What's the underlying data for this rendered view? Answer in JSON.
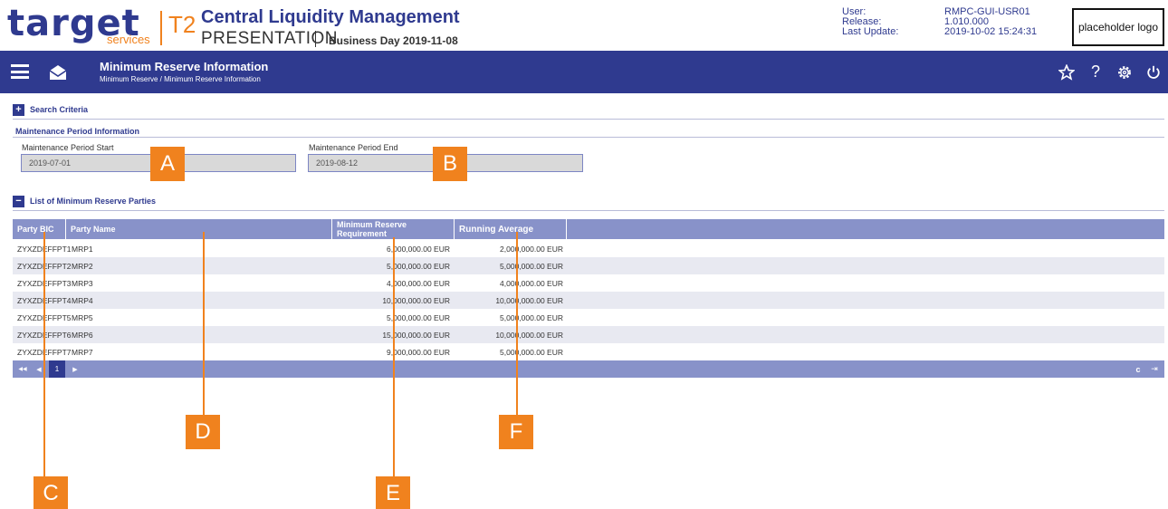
{
  "header": {
    "logo_target": "target",
    "logo_services": "services",
    "logo_t2": "T2",
    "app_title": "Central Liquidity Management",
    "environment": "PRESENTATION",
    "business_day": "Business Day 2019-11-08",
    "meta_labels": [
      "User:",
      "Release:",
      "Last Update:"
    ],
    "meta_values": [
      "RMPC-GUI-USR01",
      "1.010.000",
      "2019-10-02 15:24:31"
    ],
    "placeholder_logo": "placeholder logo"
  },
  "navbar": {
    "title": "Minimum Reserve Information",
    "breadcrumb": "Minimum Reserve  /  Minimum Reserve Information",
    "icons": [
      "menu-icon",
      "envelope-icon",
      "star-icon",
      "help-icon",
      "settings-icon",
      "power-icon"
    ],
    "help_glyph": "?"
  },
  "search_criteria": {
    "toggle": "+",
    "title": "Search Criteria"
  },
  "maintenance": {
    "title": "Maintenance Period Information",
    "start_label": "Maintenance Period Start",
    "start_value": "2019-07-01",
    "end_label": "Maintenance Period End",
    "end_value": "2019-08-12"
  },
  "list_section": {
    "toggle": "−",
    "title": "List of Minimum Reserve Parties"
  },
  "table": {
    "columns": [
      "Party BIC",
      "Party Name",
      "Minimum Reserve Requirement",
      "Running Average"
    ],
    "rows": [
      {
        "bic": "ZYXZDEFFPT1",
        "name": "MRP1",
        "requirement": "6,000,000.00  EUR",
        "average": "2,000,000.00  EUR"
      },
      {
        "bic": "ZYXZDEFFPT2",
        "name": "MRP2",
        "requirement": "5,000,000.00  EUR",
        "average": "5,000,000.00  EUR"
      },
      {
        "bic": "ZYXZDEFFPT3",
        "name": "MRP3",
        "requirement": "4,000,000.00  EUR",
        "average": "4,000,000.00  EUR"
      },
      {
        "bic": "ZYXZDEFFPT4",
        "name": "MRP4",
        "requirement": "10,000,000.00  EUR",
        "average": "10,000,000.00  EUR"
      },
      {
        "bic": "ZYXZDEFFPT5",
        "name": "MRP5",
        "requirement": "5,000,000.00  EUR",
        "average": "5,000,000.00  EUR"
      },
      {
        "bic": "ZYXZDEFFPT6",
        "name": "MRP6",
        "requirement": "15,000,000.00  EUR",
        "average": "10,000,000.00  EUR"
      },
      {
        "bic": "ZYXZDEFFPT7",
        "name": "MRP7",
        "requirement": "9,000,000.00  EUR",
        "average": "5,000,000.00  EUR"
      }
    ]
  },
  "pager": {
    "first": "◀◀",
    "prev": "◀",
    "current_page": "1",
    "next": "▶",
    "refresh": "c",
    "export": "⇥"
  },
  "callouts": [
    "A",
    "B",
    "C",
    "D",
    "E",
    "F"
  ],
  "colors": {
    "brand_blue": "#2f3a8f",
    "brand_orange": "#f0821e",
    "table_header": "#8892c9",
    "row_alt": "#e8e9f1"
  }
}
